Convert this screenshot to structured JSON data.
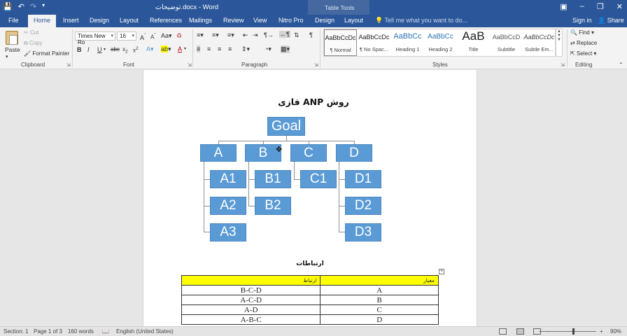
{
  "app": {
    "doc_title": "توضیحات.docx - Word",
    "table_tools_label": "Table Tools"
  },
  "tabs": {
    "file": "File",
    "home": "Home",
    "insert": "Insert",
    "design": "Design",
    "layout": "Layout",
    "references": "References",
    "mailings": "Mailings",
    "review": "Review",
    "view": "View",
    "nitro": "Nitro Pro",
    "tt_design": "Design",
    "tt_layout": "Layout"
  },
  "tellme": "Tell me what you want to do...",
  "signin": "Sign in",
  "share": "Share",
  "clipboard": {
    "paste": "Paste",
    "cut": "Cut",
    "copy": "Copy",
    "format_painter": "Format Painter",
    "label": "Clipboard"
  },
  "font": {
    "name": "Times New Ro",
    "size": "16",
    "label": "Font"
  },
  "paragraph": {
    "label": "Paragraph"
  },
  "styles": {
    "label": "Styles",
    "items": [
      {
        "preview": "AaBbCcDc",
        "name": "¶ Normal"
      },
      {
        "preview": "AaBbCcDc",
        "name": "¶ No Spac..."
      },
      {
        "preview": "AaBbCc",
        "name": "Heading 1"
      },
      {
        "preview": "AaBbCc",
        "name": "Heading 2"
      },
      {
        "preview": "AaB",
        "name": "Title"
      },
      {
        "preview": "AaBbCcD",
        "name": "Subtitle"
      },
      {
        "preview": "AaBbCcDc",
        "name": "Subtle Em..."
      }
    ]
  },
  "editing": {
    "find": "Find",
    "replace": "Replace",
    "select": "Select",
    "label": "Editing"
  },
  "document": {
    "heading": "روش ANP فازی",
    "diagram": {
      "goal": "Goal",
      "criteria": [
        "A",
        "B",
        "C",
        "D"
      ],
      "sub": {
        "A": [
          "A1",
          "A2",
          "A3"
        ],
        "B": [
          "B1",
          "B2"
        ],
        "C": [
          "C1"
        ],
        "D": [
          "D1",
          "D2",
          "D3"
        ]
      }
    },
    "table_title": "ارتباطات",
    "table": {
      "headers": [
        "ارتباط",
        "معیار"
      ],
      "rows": [
        [
          "B-C-D",
          "A"
        ],
        [
          "A-C-D",
          "B"
        ],
        [
          "A-D",
          "C"
        ],
        [
          "A-B-C",
          "D"
        ]
      ]
    }
  },
  "status": {
    "section": "Section: 1",
    "page": "Page 1 of 3",
    "words": "160 words",
    "language": "English (United States)",
    "zoom": "90%"
  },
  "colors": {
    "word_blue": "#2b579a",
    "node_fill": "#5b9bd5",
    "table_header": "#ffff00"
  }
}
